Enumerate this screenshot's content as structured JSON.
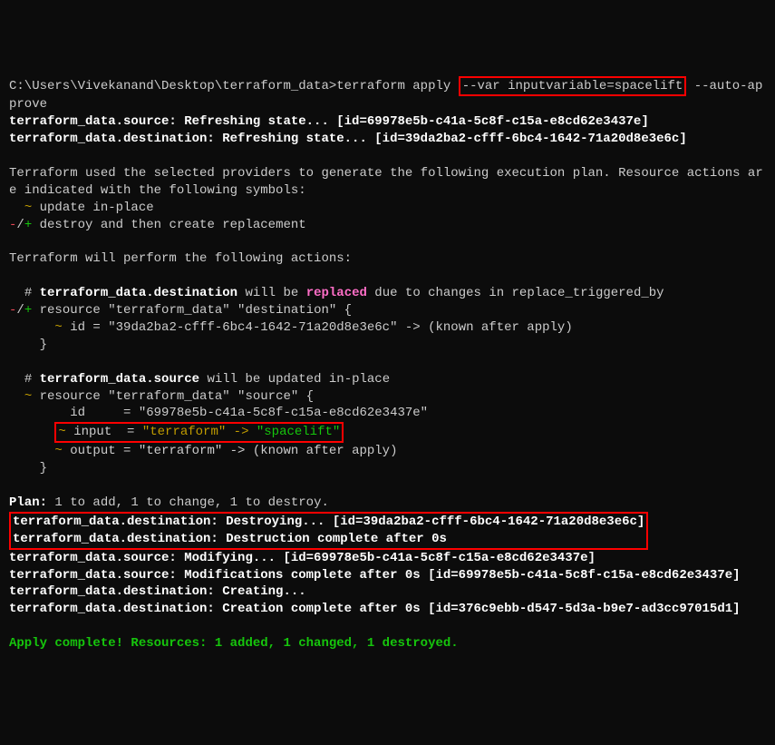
{
  "prompt": "C:\\Users\\Vivekanand\\Desktop\\terraform_data>terraform apply ",
  "var_flag": "--var inputvariable=spacelift",
  "auto_approve": " --auto-approve",
  "refresh1": "terraform_data.source: Refreshing state... [id=69978e5b-c41a-5c8f-c15a-e8cd62e3437e]",
  "refresh2": "terraform_data.destination: Refreshing state... [id=39da2ba2-cfff-6bc4-1642-71a20d8e3e6c]",
  "planmsg1": "Terraform used the selected providers to generate the following execution plan. Resource actions are indicated with the following symbols:",
  "sym1_pre": "  ",
  "sym1_tilde": "~",
  "sym1_txt": " update in-place",
  "sym2_pre": "-",
  "sym2_slash": "/",
  "sym2_plus": "+",
  "sym2_txt": " destroy and then create replacement",
  "actions_hdr": "Terraform will perform the following actions:",
  "dest_comment_pre": "  # ",
  "dest_res_name": "terraform_data.destination",
  "dest_comment_mid": " will be ",
  "dest_replaced": "replaced",
  "dest_comment_post": " due to changes in replace_triggered_by",
  "dest_res_pre": "-",
  "dest_res_slash": "/",
  "dest_res_plus": "+",
  "dest_res_decl": " resource \"terraform_data\" \"destination\" {",
  "dest_id_pre": "      ",
  "dest_id_tilde": "~",
  "dest_id_txt": " id = \"39da2ba2-cfff-6bc4-1642-71a20d8e3e6c\" -> (known after apply)",
  "dest_close": "    }",
  "src_comment_pre": "  # ",
  "src_res_name": "terraform_data.source",
  "src_comment_post": " will be updated in-place",
  "src_tilde": "  ~",
  "src_res_decl": " resource \"terraform_data\" \"source\" {",
  "src_id": "        id     = \"69978e5b-c41a-5c8f-c15a-e8cd62e3437e\"",
  "src_input_pre": "      ",
  "src_input_tilde": "~",
  "src_input_label": " input  = ",
  "src_input_old": "\"terraform\"",
  "src_input_arrow": " -> ",
  "src_input_new": "\"spacelift\"",
  "src_output_pre": "      ",
  "src_output_tilde": "~",
  "src_output_txt": " output = \"terraform\" -> (known after apply)",
  "src_close": "    }",
  "plan_label": "Plan:",
  "plan_txt": " 1 to add, 1 to change, 1 to destroy.",
  "destroy1": "terraform_data.destination: Destroying... [id=39da2ba2-cfff-6bc4-1642-71a20d8e3e6c]",
  "destroy2": "terraform_data.destination: Destruction complete after 0s",
  "modify1": "terraform_data.source: Modifying... [id=69978e5b-c41a-5c8f-c15a-e8cd62e3437e]",
  "modify2": "terraform_data.source: Modifications complete after 0s [id=69978e5b-c41a-5c8f-c15a-e8cd62e3437e]",
  "create1": "terraform_data.destination: Creating...",
  "create2": "terraform_data.destination: Creation complete after 0s [id=376c9ebb-d547-5d3a-b9e7-ad3cc97015d1]",
  "apply_complete": "Apply complete! Resources: 1 added, 1 changed, 1 destroyed."
}
